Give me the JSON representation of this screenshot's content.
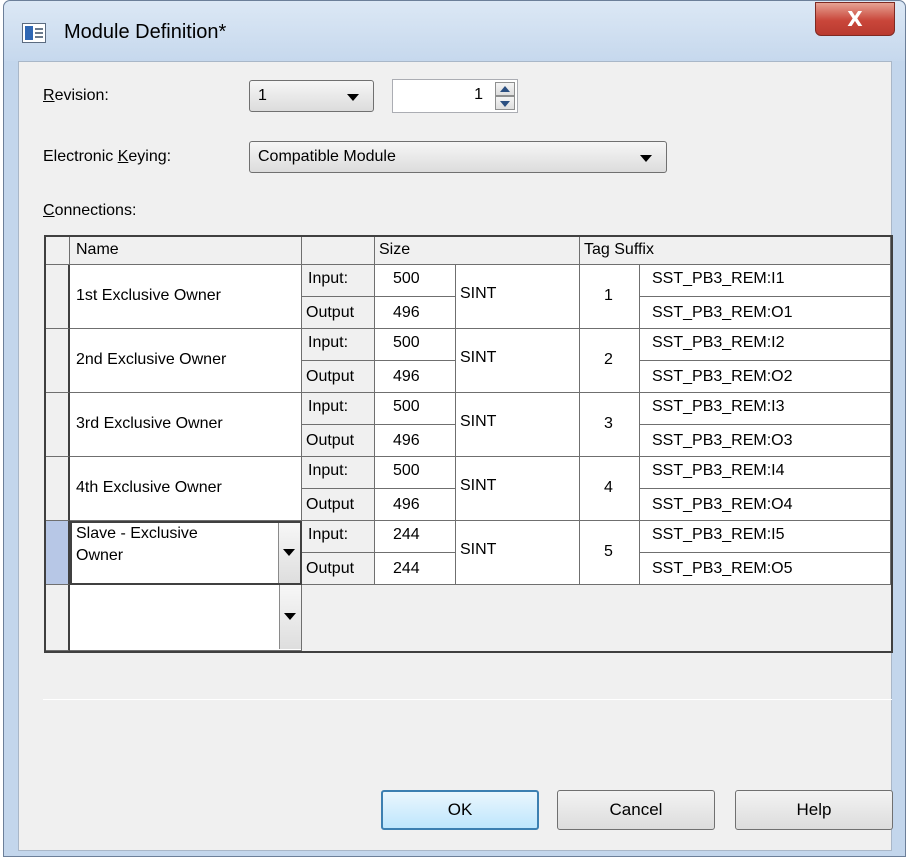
{
  "window": {
    "title": "Module Definition*",
    "close_glyph": "X"
  },
  "revision": {
    "label": "Revision:",
    "major": "1",
    "minor": "1"
  },
  "keying": {
    "label": "Electronic Keying:",
    "value": "Compatible Module"
  },
  "connections_label": "Connections:",
  "table": {
    "headers": {
      "name": "Name",
      "dir": "",
      "size": "Size",
      "tag_suffix": "Tag Suffix"
    },
    "rows": [
      {
        "name": "1st Exclusive Owner",
        "in_label": "Input:",
        "in_size": "500",
        "out_label": "Output",
        "out_size": "496",
        "type": "SINT",
        "num": "1",
        "tag_in": "SST_PB3_REM:I1",
        "tag_out": "SST_PB3_REM:O1"
      },
      {
        "name": "2nd Exclusive Owner",
        "in_label": "Input:",
        "in_size": "500",
        "out_label": "Output",
        "out_size": "496",
        "type": "SINT",
        "num": "2",
        "tag_in": "SST_PB3_REM:I2",
        "tag_out": "SST_PB3_REM:O2"
      },
      {
        "name": "3rd Exclusive Owner",
        "in_label": "Input:",
        "in_size": "500",
        "out_label": "Output",
        "out_size": "496",
        "type": "SINT",
        "num": "3",
        "tag_in": "SST_PB3_REM:I3",
        "tag_out": "SST_PB3_REM:O3"
      },
      {
        "name": "4th Exclusive Owner",
        "in_label": "Input:",
        "in_size": "500",
        "out_label": "Output",
        "out_size": "496",
        "type": "SINT",
        "num": "4",
        "tag_in": "SST_PB3_REM:I4",
        "tag_out": "SST_PB3_REM:O4"
      },
      {
        "name_line1": "Slave - Exclusive",
        "name_line2": "Owner",
        "in_label": "Input:",
        "in_size": "244",
        "out_label": "Output",
        "out_size": "244",
        "type": "SINT",
        "num": "5",
        "tag_in": "SST_PB3_REM:I5",
        "tag_out": "SST_PB3_REM:O5"
      }
    ]
  },
  "buttons": {
    "ok": "OK",
    "cancel": "Cancel",
    "help": "Help"
  }
}
